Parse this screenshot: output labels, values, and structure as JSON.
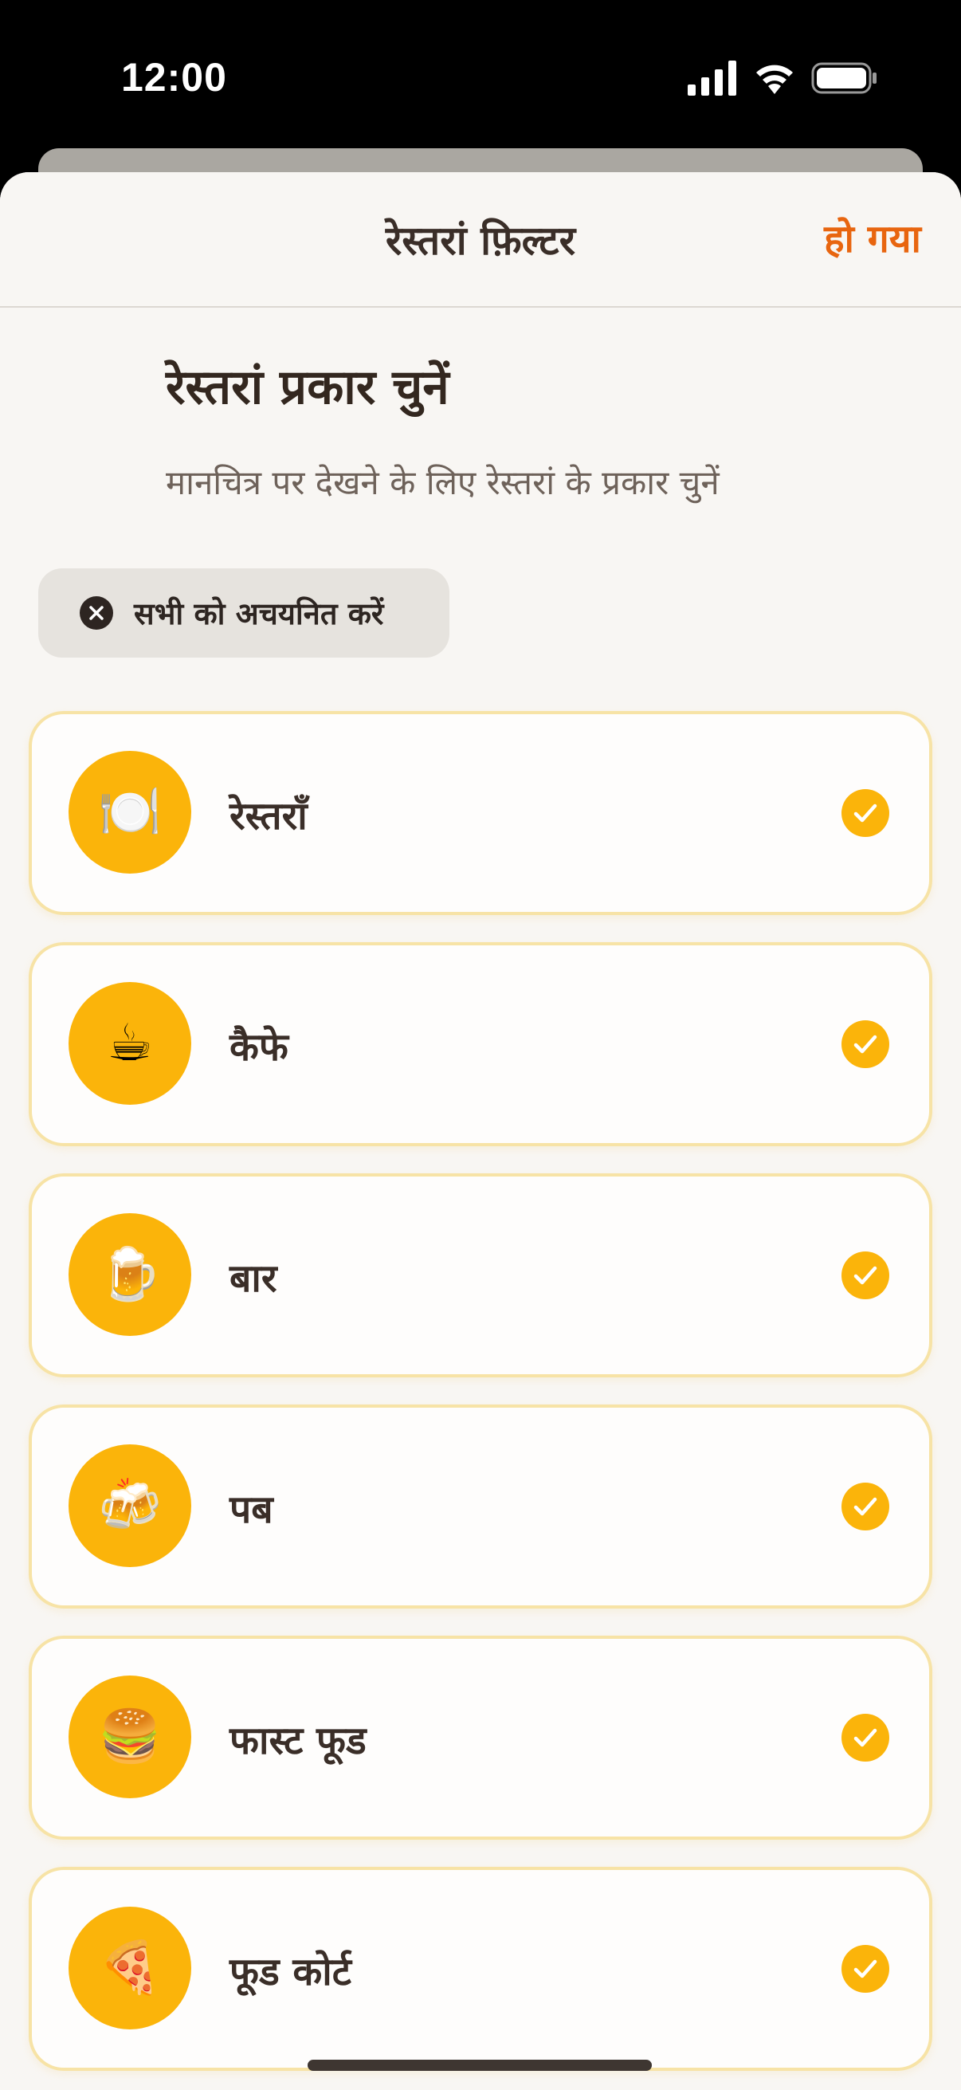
{
  "status_bar": {
    "time": "12:00"
  },
  "nav": {
    "title": "रेस्तरां फ़िल्टर",
    "done_label": "हो गया"
  },
  "heading": "रेस्तरां प्रकार चुनें",
  "subheading": "मानचित्र पर देखने के लिए रेस्तरां के प्रकार चुनें",
  "deselect_all_label": "सभी को अचयनित करें",
  "colors": {
    "accent": "#fbb40a",
    "done": "#e8650f",
    "card_border": "#f7e3a6"
  },
  "items": [
    {
      "label": "रेस्तराँ",
      "icon": "plate-cutlery-icon",
      "emoji": "🍽️",
      "selected": true
    },
    {
      "label": "कैफे",
      "icon": "coffee-cup-icon",
      "emoji": "☕",
      "selected": true
    },
    {
      "label": "बार",
      "icon": "beer-mug-icon",
      "emoji": "🍺",
      "selected": true
    },
    {
      "label": "पब",
      "icon": "clinking-beers-icon",
      "emoji": "🍻",
      "selected": true
    },
    {
      "label": "फास्ट फूड",
      "icon": "burger-icon",
      "emoji": "🍔",
      "selected": true
    },
    {
      "label": "फूड कोर्ट",
      "icon": "pizza-icon",
      "emoji": "🍕",
      "selected": true
    }
  ]
}
